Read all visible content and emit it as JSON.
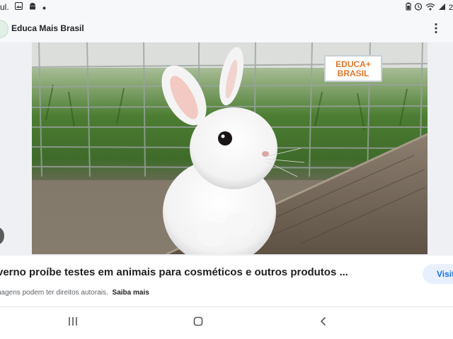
{
  "status_bar": {
    "carrier_fragment": "ul.",
    "time_fragment": "2",
    "icons": [
      "gallery-icon",
      "android-icon",
      "dot-icon",
      "battery-icon",
      "alarm-icon",
      "wifi-icon",
      "signal-icon"
    ]
  },
  "header": {
    "site_name": "Educa Mais Brasil",
    "menu_icon": "more-vert-icon"
  },
  "image": {
    "logo_line1": "EDUCA+",
    "logo_line2": "BRASIL",
    "logo_color": "#e0782c"
  },
  "result": {
    "title": "verno proíbe testes em animais para cosméticos e outros produtos ...",
    "visit_label": "Visit",
    "copyright_text": "nagens podem ter direitos autorais.",
    "learn_more": "Saiba mais"
  },
  "nav_bar": {
    "buttons": [
      "recents-icon",
      "home-icon",
      "back-icon"
    ]
  },
  "colors": {
    "accent": "#1a73e8",
    "button_bg": "#e8f0fe",
    "background": "#f2f4f7"
  }
}
